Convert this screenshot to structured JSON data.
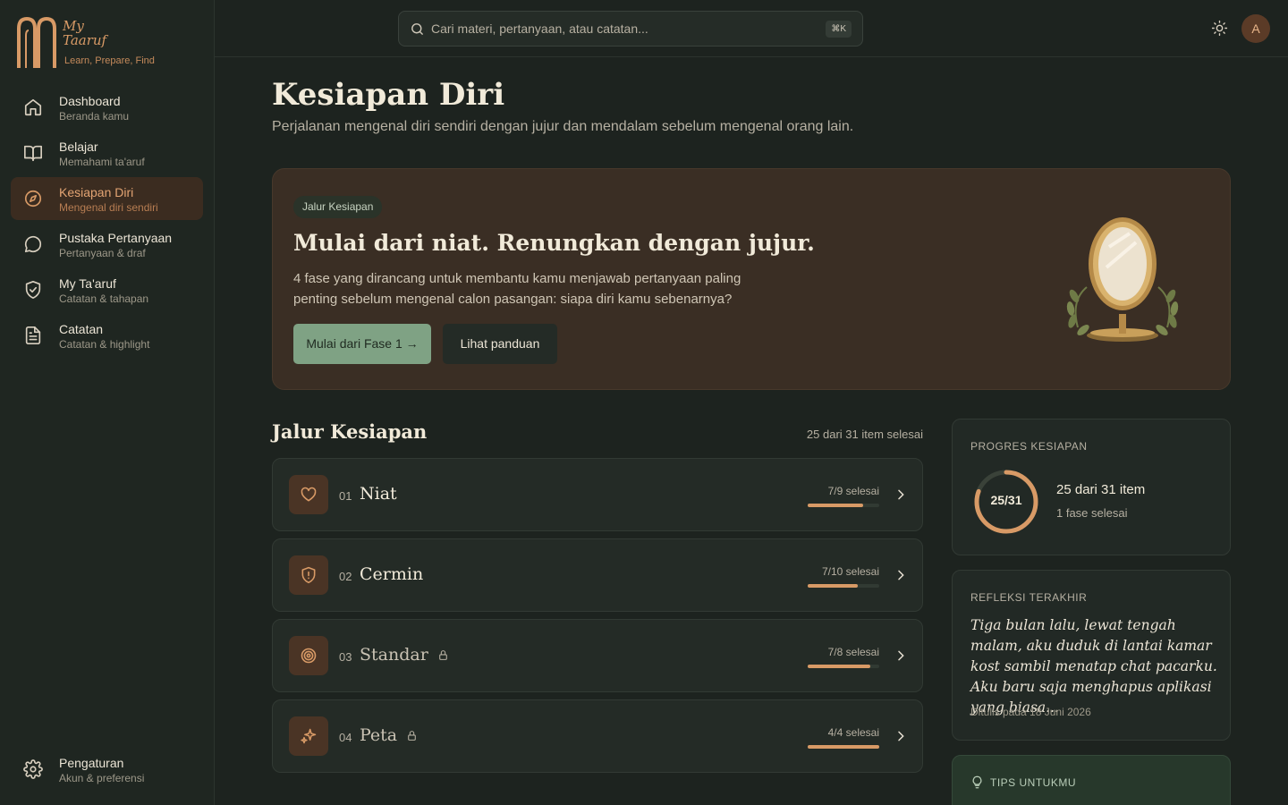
{
  "brand": {
    "name": "My\nTaaruf",
    "tagline": "Learn, Prepare, Find"
  },
  "sidebar": {
    "items": [
      {
        "label": "Dashboard",
        "sub": "Beranda kamu",
        "icon": "home-icon",
        "active": false
      },
      {
        "label": "Belajar",
        "sub": "Memahami ta'aruf",
        "icon": "book-open-icon",
        "active": false
      },
      {
        "label": "Kesiapan Diri",
        "sub": "Mengenal diri sendiri",
        "icon": "compass-icon",
        "active": true
      },
      {
        "label": "Pustaka Pertanyaan",
        "sub": "Pertanyaan & draf",
        "icon": "message-circle-icon",
        "active": false
      },
      {
        "label": "My Ta'aruf",
        "sub": "Catatan & tahapan",
        "icon": "shield-check-icon",
        "active": false
      },
      {
        "label": "Catatan",
        "sub": "Catatan & highlight",
        "icon": "file-text-icon",
        "active": false
      }
    ],
    "settings": {
      "label": "Pengaturan",
      "sub": "Akun & preferensi",
      "icon": "gear-icon"
    }
  },
  "topbar": {
    "search_placeholder": "Cari materi, pertanyaan, atau catatan...",
    "shortcut": "⌘K",
    "avatar_initial": "A"
  },
  "page": {
    "title": "Kesiapan Diri",
    "subtitle": "Perjalanan mengenal diri sendiri dengan jujur dan mendalam sebelum mengenal orang lain."
  },
  "hero": {
    "badge": "Jalur Kesiapan",
    "title": "Mulai dari niat. Renungkan dengan jujur.",
    "description": "4 fase yang dirancang untuk membantu kamu menjawab pertanyaan paling penting sebelum mengenal calon pasangan: siapa diri kamu sebenarnya?",
    "primary_button": "Mulai dari Fase 1 →",
    "secondary_button": "Lihat panduan"
  },
  "path": {
    "title": "Jalur Kesiapan",
    "count": "25 dari 31 item selesai",
    "phases": [
      {
        "num": "01",
        "name": "Niat",
        "progress_text": "7/9 selesai",
        "progress": 0.778,
        "locked": false,
        "icon": "heart-icon"
      },
      {
        "num": "02",
        "name": "Cermin",
        "progress_text": "7/10 selesai",
        "progress": 0.7,
        "locked": false,
        "icon": "shield-alert-icon"
      },
      {
        "num": "03",
        "name": "Standar",
        "progress_text": "7/8 selesai",
        "progress": 0.875,
        "locked": true,
        "icon": "target-icon"
      },
      {
        "num": "04",
        "name": "Peta",
        "progress_text": "4/4 selesai",
        "progress": 1.0,
        "locked": true,
        "icon": "sparkles-icon"
      }
    ]
  },
  "progress_card": {
    "label": "PROGRES KESIAPAN",
    "ring_text": "25/31",
    "ring_value": 0.806,
    "main": "25 dari 31 item",
    "sub": "1 fase selesai"
  },
  "reflection_card": {
    "label": "REFLEKSI TERAKHIR",
    "text": "Tiga bulan lalu, lewat tengah malam, aku duduk di lantai kamar kost sambil menatap chat pacarku. Aku baru saja menghapus aplikasi yang biasa...",
    "date": "Ditulis pada 18 Juni 2026"
  },
  "tips_card": {
    "label": "TIPS UNTUKMU"
  },
  "colors": {
    "accent": "#d89a66",
    "primary_button": "#7fa284",
    "background": "#1d231f"
  }
}
